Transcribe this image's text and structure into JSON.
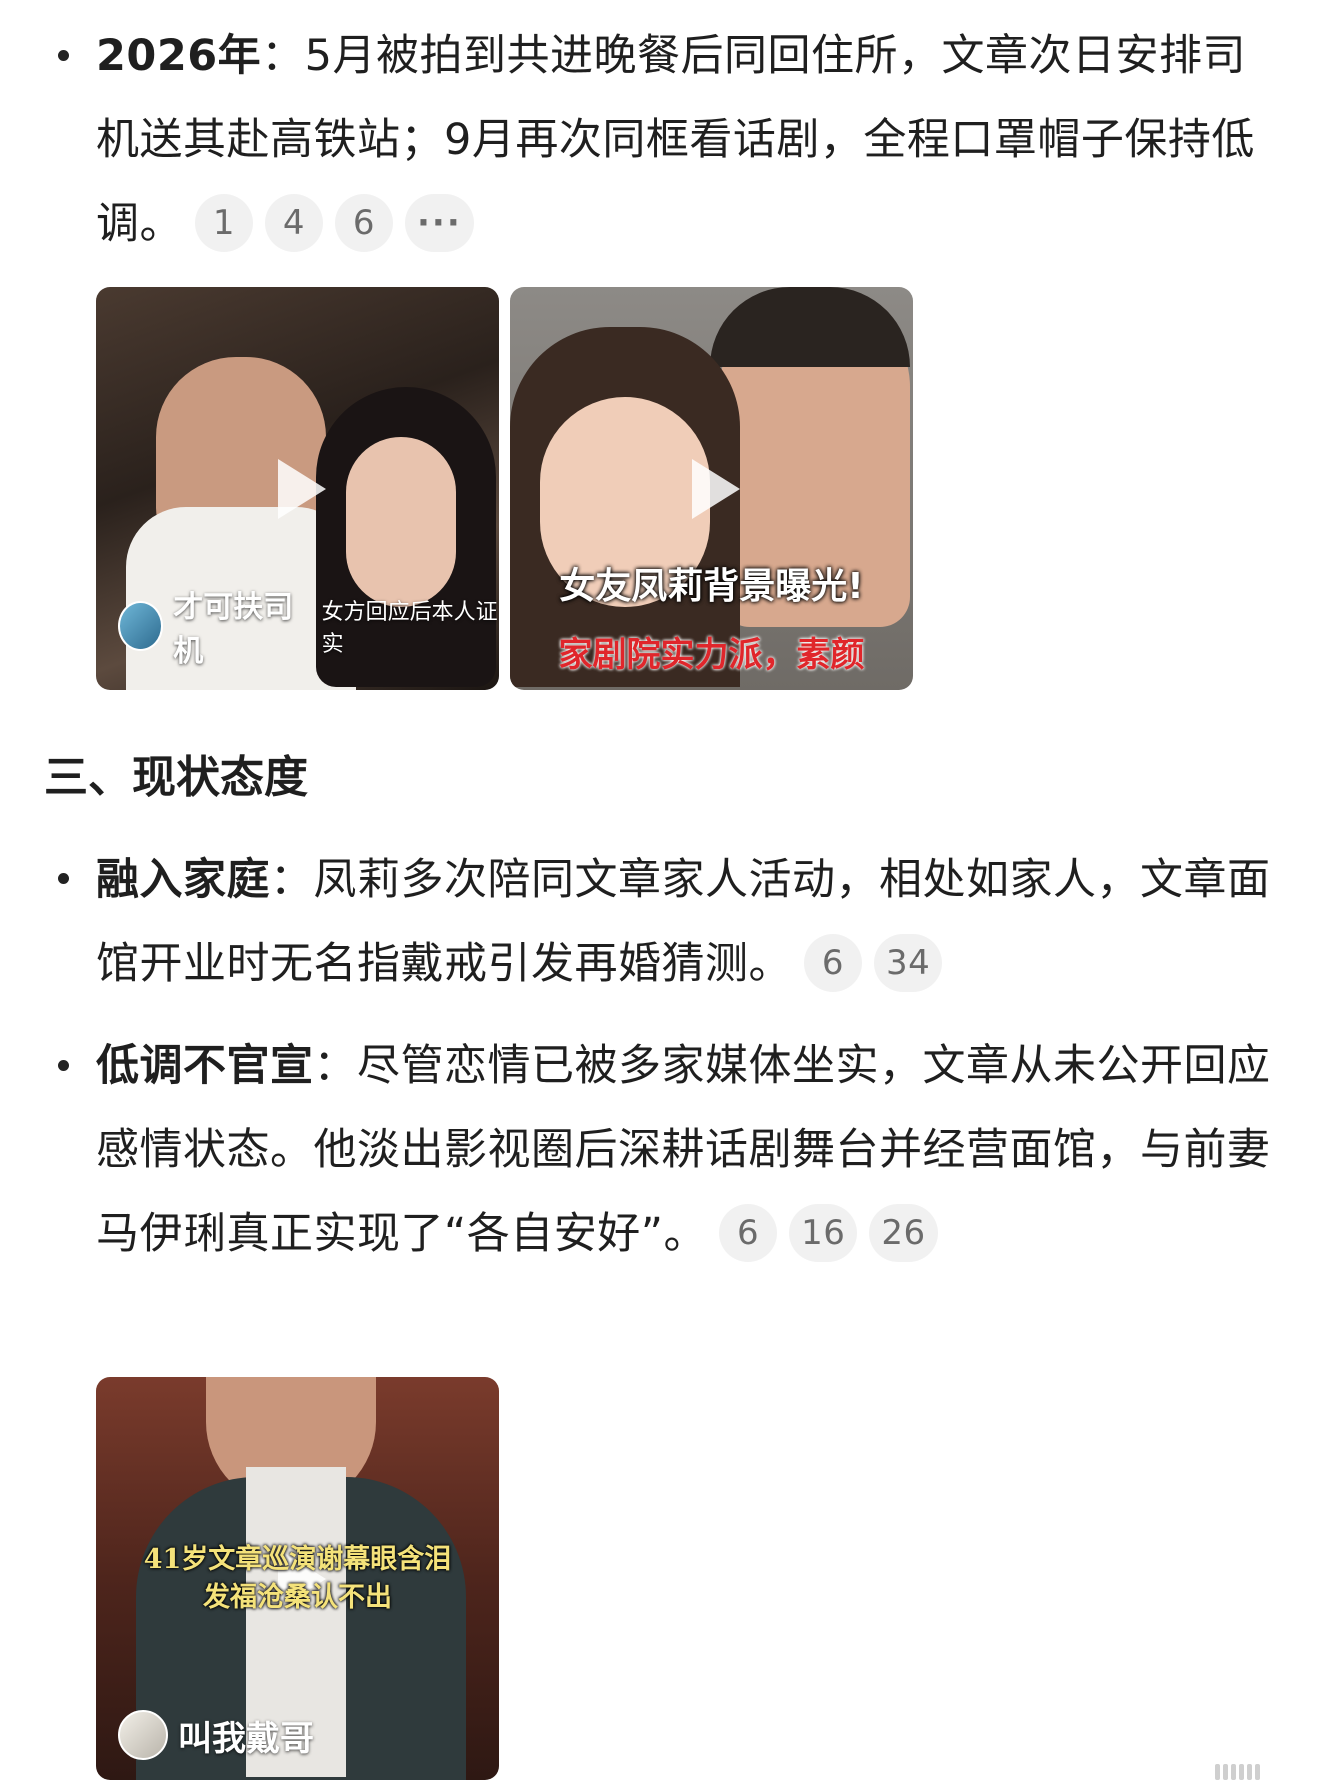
{
  "bullets_top": [
    {
      "bold": "2026年",
      "text": "：5月被拍到共进晚餐后同回住所，文章次日安排司机送其赴高铁站；9月再次同框看话剧，全程口罩帽子保持低调。",
      "citations": [
        "1",
        "4",
        "6",
        "···"
      ]
    }
  ],
  "media_row_1": [
    {
      "author": "才可扶司机",
      "caption": "女方回应后本人证实",
      "icon": "play-icon"
    },
    {
      "headline": "女友凤莉背景曝光!",
      "caption": "家剧院实力派，素颜",
      "icon": "play-icon"
    }
  ],
  "section": {
    "title": "三、现状态度"
  },
  "bullets_bottom": [
    {
      "bold": "融入家庭",
      "text": "：凤莉多次陪同文章家人活动，相处如家人，文章面馆开业时无名指戴戒引发再婚猜测。",
      "citations": [
        "6",
        "34"
      ]
    },
    {
      "bold": "低调不官宣",
      "text": "：尽管恋情已被多家媒体坐实，文章从未公开回应感情状态。他淡出影视圈后深耕话剧舞台并经营面馆，与前妻马伊琍真正实现了“各自安好”。",
      "citations": [
        "6",
        "16",
        "26"
      ]
    }
  ],
  "media_row_2": [
    {
      "overlay_line1": "41岁文章巡演谢幕眼含泪",
      "overlay_line2": "发福沧桑认不出",
      "author": "叫我戴哥",
      "icon": "play-icon"
    }
  ],
  "colors": {
    "text": "#1f1f1f",
    "citation_bg": "#f1f1f1",
    "citation_text": "#6b6b6b",
    "caption_red": "#e0262b"
  }
}
